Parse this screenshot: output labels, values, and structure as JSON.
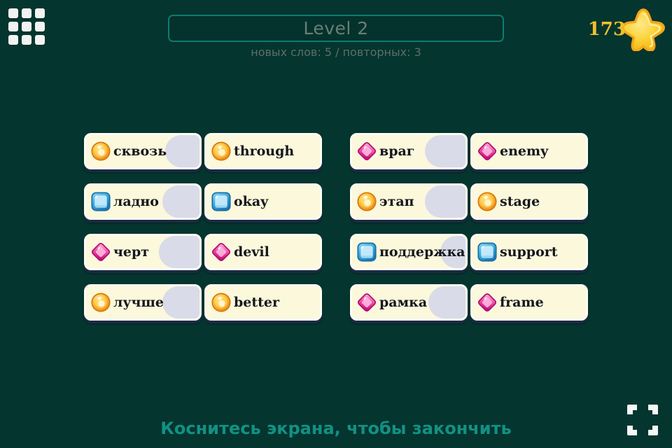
{
  "background_color": "#04352e",
  "header": {
    "menu_icon": "grid-menu-icon",
    "level_title": "Level 2",
    "subtitle": "новых слов: 5 / повторных: 3",
    "score": "173",
    "star_icon": "star-icon",
    "accent_border": "#0c7b72",
    "title_color": "#6c7d77",
    "score_color": "#f0c129"
  },
  "board": {
    "rows": [
      {
        "left": {
          "source": {
            "word": "сквозь",
            "gem": "gem-circle-orange",
            "fill_pct": 30
          },
          "target": {
            "word": "through",
            "gem": "gem-circle-orange",
            "fill_pct": 0
          }
        },
        "right": {
          "source": {
            "word": "враг",
            "gem": "gem-diamond-pink",
            "fill_pct": 36
          },
          "target": {
            "word": "enemy",
            "gem": "gem-diamond-pink",
            "fill_pct": 0
          }
        }
      },
      {
        "left": {
          "source": {
            "word": "ладно",
            "gem": "gem-square-blue",
            "fill_pct": 33
          },
          "target": {
            "word": "okay",
            "gem": "gem-square-blue",
            "fill_pct": 0
          }
        },
        "right": {
          "source": {
            "word": "этап",
            "gem": "gem-circle-orange",
            "fill_pct": 36
          },
          "target": {
            "word": "stage",
            "gem": "gem-circle-orange",
            "fill_pct": 0
          }
        }
      },
      {
        "left": {
          "source": {
            "word": "черт",
            "gem": "gem-diamond-pink",
            "fill_pct": 36
          },
          "target": {
            "word": "devil",
            "gem": "gem-diamond-pink",
            "fill_pct": 0
          }
        },
        "right": {
          "source": {
            "word": "поддержка",
            "gem": "gem-square-blue",
            "fill_pct": 22
          },
          "target": {
            "word": "support",
            "gem": "gem-square-blue",
            "fill_pct": 0
          }
        }
      },
      {
        "left": {
          "source": {
            "word": "лучше",
            "gem": "gem-circle-orange",
            "fill_pct": 33
          },
          "target": {
            "word": "better",
            "gem": "gem-circle-orange",
            "fill_pct": 0
          }
        },
        "right": {
          "source": {
            "word": "рамка",
            "gem": "gem-diamond-pink",
            "fill_pct": 33
          },
          "target": {
            "word": "frame",
            "gem": "gem-diamond-pink",
            "fill_pct": 0
          }
        }
      }
    ],
    "card_background": "#fbf8dc",
    "card_fill_color": "#d9dbe8",
    "card_shadow_color": "#1b2b44"
  },
  "footer": {
    "hint": "Коснитесь экрана, чтобы закончить",
    "hint_color": "#129184",
    "fullscreen_icon": "fullscreen-icon"
  }
}
